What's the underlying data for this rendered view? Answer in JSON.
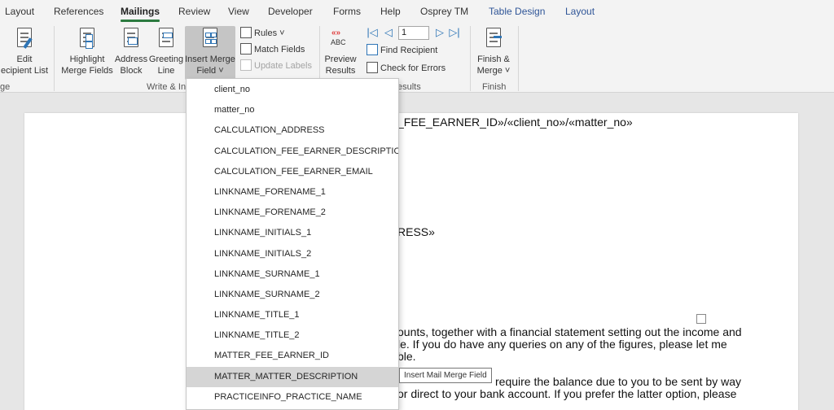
{
  "tabs": [
    "Layout",
    "References",
    "Mailings",
    "Review",
    "View",
    "Developer",
    "Forms",
    "Help",
    "Osprey TM",
    "Table Design",
    "Layout"
  ],
  "active_tab": "Mailings",
  "ribbon": {
    "edit_recipient_list": [
      "Edit",
      "ecipient List"
    ],
    "group_start_label": "ge",
    "highlight_merge_fields": [
      "Highlight",
      "Merge Fields"
    ],
    "address_block": [
      "Address",
      "Block"
    ],
    "greeting_line": [
      "Greeting",
      "Line"
    ],
    "insert_merge_field": [
      "Insert Merge",
      "Field ˅"
    ],
    "rules": "Rules ˅",
    "match_fields": "Match Fields",
    "update_labels": "Update Labels",
    "group_write_label": "Write & In",
    "preview_results": [
      "Preview",
      "Results"
    ],
    "preview_icon_text": "ABC",
    "preview_icon_arrows": "«»",
    "record_number": "1",
    "find_recipient": "Find Recipient",
    "check_for_errors": "Check for Errors",
    "group_preview_label": "esults",
    "finish_merge": [
      "Finish &",
      "Merge ˅"
    ],
    "group_finish_label": "Finish",
    "nav_first": "|◁",
    "nav_prev": "◁",
    "nav_next": "▷",
    "nav_last": "▷|"
  },
  "document": {
    "line1": "_FEE_EARNER_ID»/«client_no»/«matter_no»",
    "line2": "RESS»",
    "line3": "ounts, together with a financial statement setting out the income and",
    "line4": "le.  If you do have any queries on any of the figures, please let me",
    "line5": "ble.",
    "line6": "require the balance due to you to be sent by way",
    "line7": "or direct to your bank account.  If you prefer the latter option, please"
  },
  "dropdown": {
    "items": [
      "client_no",
      "matter_no",
      "CALCULATION_ADDRESS",
      "CALCULATION_FEE_EARNER_DESCRIPTION",
      "CALCULATION_FEE_EARNER_EMAIL",
      "LINKNAME_FORENAME_1",
      "LINKNAME_FORENAME_2",
      "LINKNAME_INITIALS_1",
      "LINKNAME_INITIALS_2",
      "LINKNAME_SURNAME_1",
      "LINKNAME_SURNAME_2",
      "LINKNAME_TITLE_1",
      "LINKNAME_TITLE_2",
      "MATTER_FEE_EARNER_ID",
      "MATTER_MATTER_DESCRIPTION",
      "PRACTICEINFO_PRACTICE_NAME"
    ],
    "hovered": "MATTER_MATTER_DESCRIPTION"
  },
  "tooltip": "Insert Mail Merge Field",
  "colors": {
    "accent": "#2b7a3f",
    "context_tab": "#2f5597",
    "icon_blue": "#2e75b6"
  }
}
